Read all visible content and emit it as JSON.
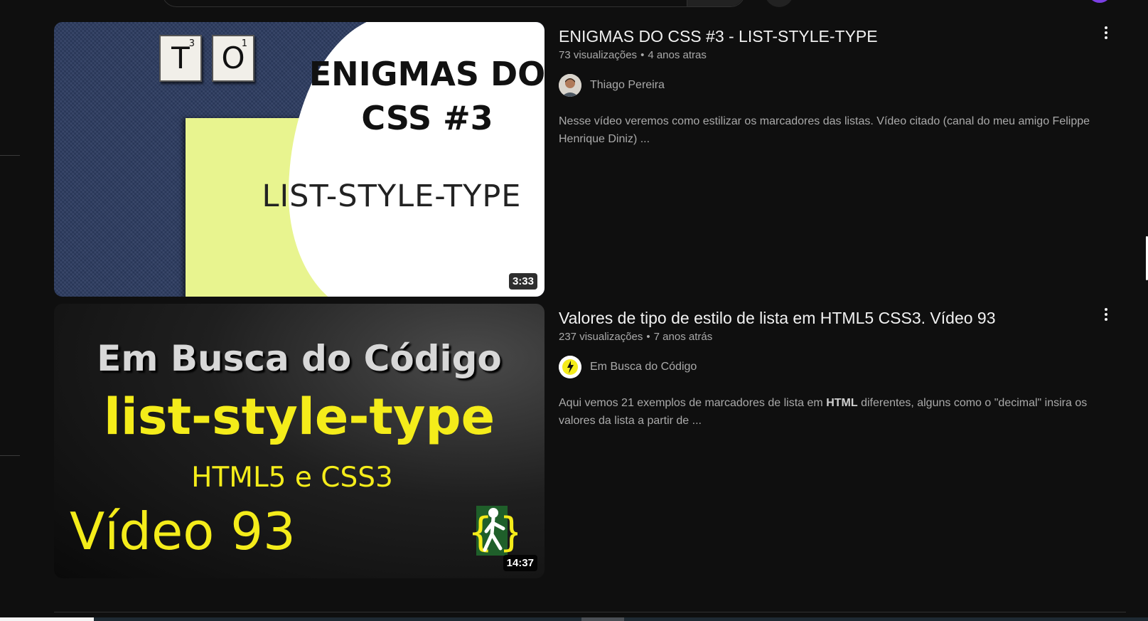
{
  "results": [
    {
      "title": "ENIGMAS DO CSS #3 - LIST-STYLE-TYPE",
      "views": "73 visualizações",
      "age": "4 anos atras",
      "channel": "Thiago Pereira",
      "description": "Nesse vídeo veremos como estilizar os marcadores das listas. Vídeo citado (canal do meu amigo Felippe Henrique Diniz) ...",
      "duration": "3:33",
      "thumb": {
        "tile1_letter": "T",
        "tile1_score": "3",
        "tile2_letter": "O",
        "tile2_score": "1",
        "heading_line1": "ENIGMAS DO",
        "heading_line2": "CSS #3",
        "subtitle": "LIST-STYLE-TYPE"
      }
    },
    {
      "title": "Valores de tipo de estilo de lista em HTML5 CSS3. Vídeo 93",
      "views": "237 visualizações",
      "age": "7 anos atrás",
      "channel": "Em Busca do Código",
      "description_before": "Aqui vemos 21 exemplos de marcadores de lista em ",
      "description_bold": "HTML",
      "description_after": " diferentes, alguns como o \"decimal\" insira os valores da lista a partir de ...",
      "duration": "14:37",
      "thumb": {
        "line1": "Em Busca do Código",
        "line2": "list-style-type",
        "line3": "HTML5 e CSS3",
        "line4": "Vídeo 93"
      }
    }
  ],
  "colors": {
    "background": "#0f0f0f",
    "title": "#f1f1f1",
    "meta": "#aaaaaa",
    "accent_yellow": "#f4ec1a"
  },
  "icons": [
    "more-vert-icon",
    "channel-avatar",
    "search-button",
    "mic-button"
  ]
}
